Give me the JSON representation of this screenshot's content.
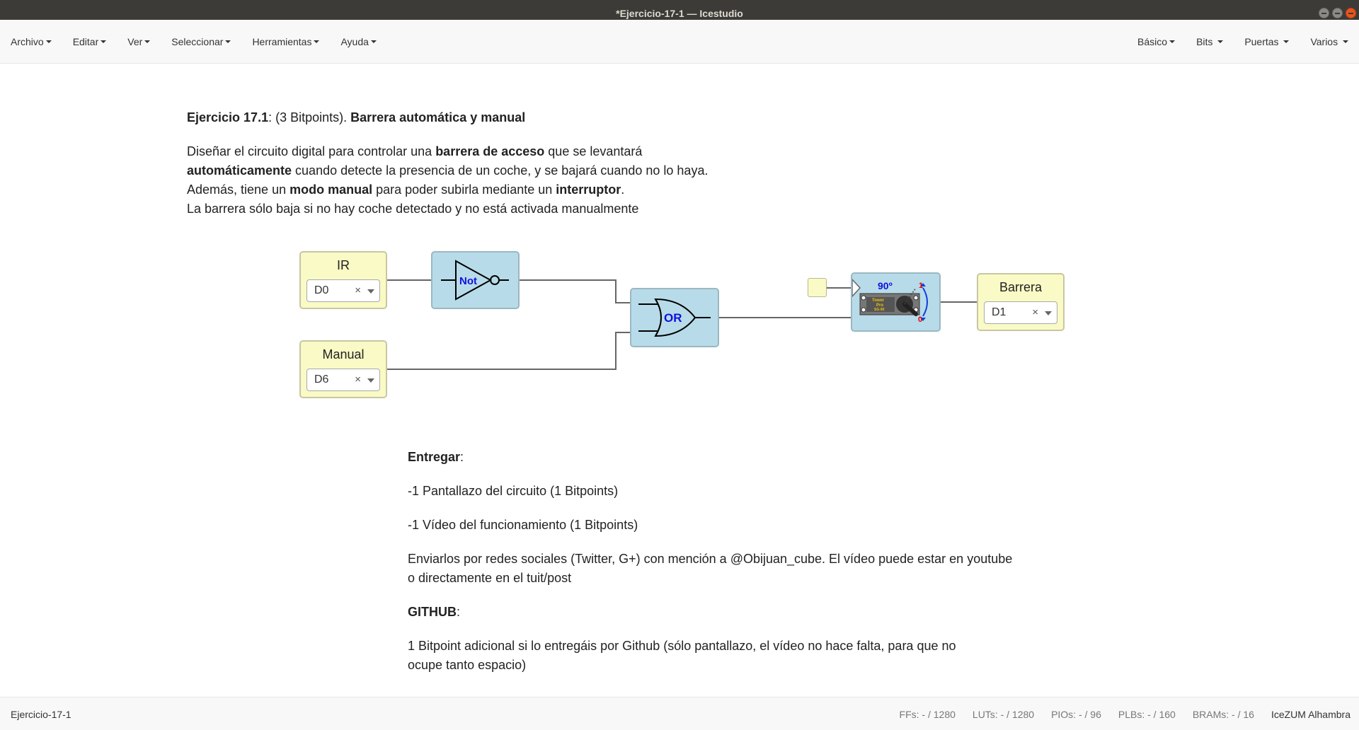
{
  "window": {
    "title": "*Ejercicio-17-1 — Icestudio"
  },
  "menubar": {
    "left": [
      "Archivo",
      "Editar",
      "Ver",
      "Seleccionar",
      "Herramientas",
      "Ayuda"
    ],
    "right": [
      "Básico",
      "Bits",
      "Puertas",
      "Varios"
    ]
  },
  "info_top": {
    "title_bold": "Ejercicio 17.1",
    "title_mid": ": (3 Bitpoints). ",
    "title_bold2": "Barrera automática y manual",
    "l1a": "Diseñar el circuito digital para controlar una ",
    "l1b": "barrera de acceso",
    "l1c": " que se levantará",
    "l2a": "automáticamente",
    "l2b": " cuando detecte la presencia de un coche, y se bajará cuando no lo haya.",
    "l3a": "Además, tiene un ",
    "l3b": "modo manual",
    "l3c": " para poder subirla mediante un ",
    "l3d": "interruptor",
    "l3e": ".",
    "l4": "La barrera sólo baja si no hay coche detectado y no está activada manualmente"
  },
  "circuit": {
    "input_ir": {
      "label": "IR",
      "pin": "D0"
    },
    "input_manual": {
      "label": "Manual",
      "pin": "D6"
    },
    "not_gate": {
      "label": "Not"
    },
    "or_gate": {
      "label": "OR"
    },
    "servo": {
      "angle": "90º",
      "text1": "Tower",
      "text2": "Pro",
      "text3": "SG-90",
      "mark_top": "1",
      "mark_bottom": "0"
    },
    "output_barrera": {
      "label": "Barrera",
      "pin": "D1"
    },
    "clear_symbol": "×",
    "colors": {
      "io_fill": "#fafac6",
      "gate_fill": "#b8dbe9",
      "gate_text": "#1010e0"
    }
  },
  "info_bottom": {
    "entregar": "Entregar",
    "colon": ":",
    "item1": "-1 Pantallazo del circuito (1 Bitpoints)",
    "item2": "-1 Vídeo del funcionamiento (1 Bitpoints)",
    "send1": "Enviarlos por redes sociales (Twitter, G+) con mención a @Obijuan_cube. El vídeo puede estar en youtube",
    "send2": "o directamente en el tuit/post",
    "github": "GITHUB",
    "gh1": "1 Bitpoint adicional si lo entregáis por Github (sólo pantallazo, el vídeo no hace falta, para que no",
    "gh2": "ocupe tanto espacio)"
  },
  "statusbar": {
    "file": "Ejercicio-17-1",
    "ffs": "FFs:  - / 1280",
    "luts": "LUTs:  - / 1280",
    "pios": "PIOs:  - / 96",
    "plbs": "PLBs:  - / 160",
    "brams": "BRAMs:  - / 16",
    "board": "IceZUM Alhambra"
  }
}
